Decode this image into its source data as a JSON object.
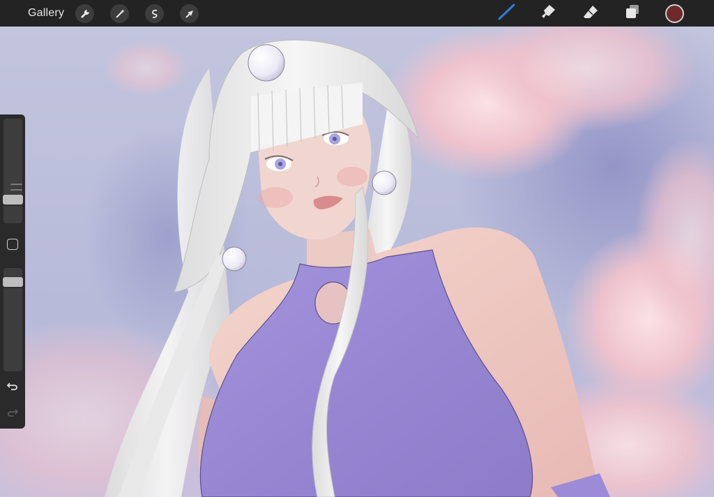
{
  "app": {
    "gallery_label": "Gallery"
  },
  "toolbar": {
    "actions": [
      {
        "icon": "wrench-icon",
        "name": "actions"
      },
      {
        "icon": "magic-wand-icon",
        "name": "adjustments"
      },
      {
        "icon": "selection-s-icon",
        "name": "selection"
      },
      {
        "icon": "arrow-cursor-icon",
        "name": "transform"
      }
    ],
    "tools": [
      {
        "icon": "brush-icon",
        "name": "paint",
        "active": true
      },
      {
        "icon": "smudge-icon",
        "name": "smudge",
        "active": false
      },
      {
        "icon": "eraser-icon",
        "name": "erase",
        "active": false
      },
      {
        "icon": "layers-icon",
        "name": "layers",
        "active": false
      }
    ],
    "current_color": "#6e2a2a",
    "active_tool_color": "#2f7de1"
  },
  "sidebar": {
    "brush_size_level": 0.2,
    "opacity_level": 0.9,
    "icons": [
      "modify-square-icon",
      "undo-icon",
      "redo-icon"
    ]
  },
  "colors": {
    "toolbar_bg": "#232323",
    "sidebar_bg": "#2a2a2a",
    "sky": "#b9bcd9",
    "top_fabric": "#9b89d6",
    "skin": "#efc9c2",
    "hair": "#eeeeee",
    "cloud_pink": "#f3c8d0"
  }
}
